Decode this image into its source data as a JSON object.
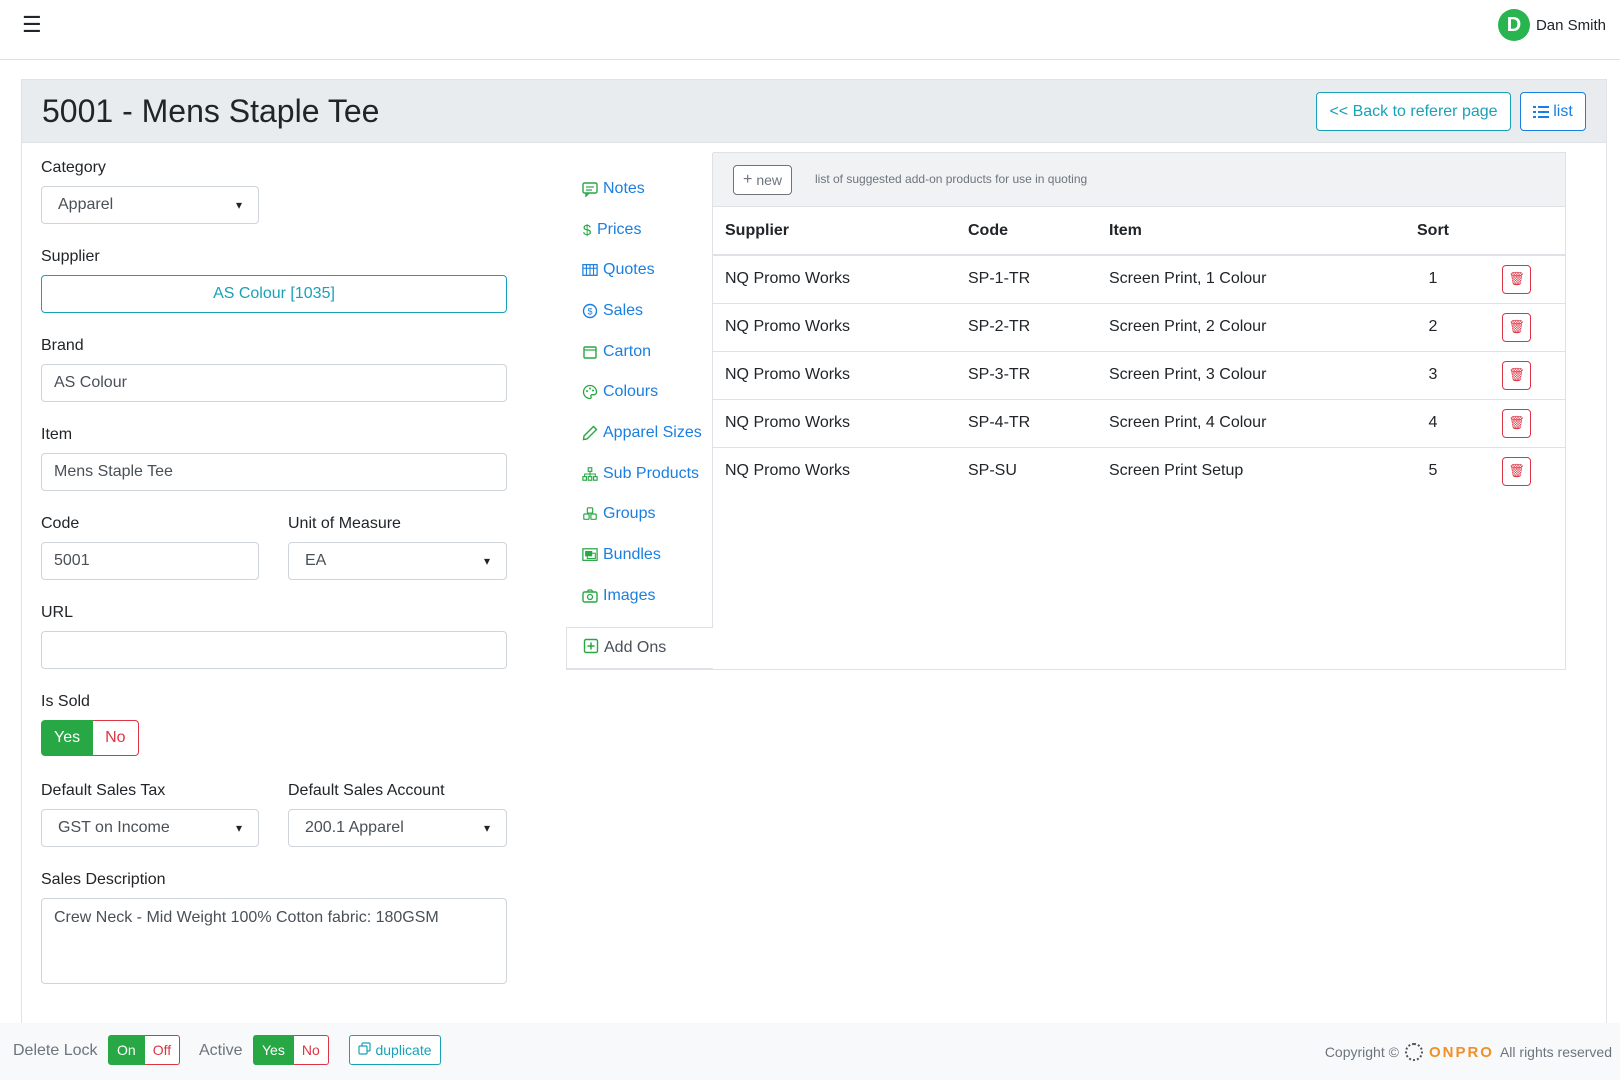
{
  "header": {
    "menu_icon": "hamburger-menu-icon",
    "user": {
      "initial": "D",
      "name": "Dan Smith",
      "avatar_color": "#28b44f"
    }
  },
  "page": {
    "title": "5001 - Mens Staple Tee",
    "back_label": "<< Back to referer page",
    "list_label": "list"
  },
  "form": {
    "category": {
      "label": "Category",
      "value": "Apparel"
    },
    "supplier": {
      "label": "Supplier",
      "value": "AS Colour [1035]"
    },
    "brand": {
      "label": "Brand",
      "value": "AS Colour"
    },
    "item": {
      "label": "Item",
      "value": "Mens Staple Tee"
    },
    "code": {
      "label": "Code",
      "value": "5001"
    },
    "unit_of_measure": {
      "label": "Unit of Measure",
      "value": "EA"
    },
    "url": {
      "label": "URL",
      "value": ""
    },
    "is_sold": {
      "label": "Is Sold",
      "yes": "Yes",
      "no": "No",
      "selected": "Yes"
    },
    "default_sales_tax": {
      "label": "Default Sales Tax",
      "value": "GST on Income"
    },
    "default_sales_account": {
      "label": "Default Sales Account",
      "value": "200.1 Apparel"
    },
    "sales_description": {
      "label": "Sales Description",
      "value": "Crew Neck - Mid Weight 100% Cotton fabric: 180GSM"
    }
  },
  "sidenav": {
    "items": [
      {
        "label": "Notes",
        "icon": "chat-icon"
      },
      {
        "label": "Prices",
        "icon": "dollar-icon"
      },
      {
        "label": "Quotes",
        "icon": "table-icon"
      },
      {
        "label": "Sales",
        "icon": "coin-icon"
      },
      {
        "label": "Carton",
        "icon": "box-icon"
      },
      {
        "label": "Colours",
        "icon": "palette-icon"
      },
      {
        "label": "Apparel Sizes",
        "icon": "ruler-pencil-icon"
      },
      {
        "label": "Sub Products",
        "icon": "hierarchy-icon"
      },
      {
        "label": "Groups",
        "icon": "boxes-icon"
      },
      {
        "label": "Bundles",
        "icon": "bundle-icon"
      },
      {
        "label": "Images",
        "icon": "camera-icon"
      }
    ],
    "active": {
      "label": "Add Ons",
      "icon": "plus-square-icon"
    }
  },
  "addons": {
    "new_label": "new",
    "hint": "list of suggested add-on products for use in quoting",
    "columns": [
      "Supplier",
      "Code",
      "Item",
      "Sort"
    ],
    "rows": [
      {
        "supplier": "NQ Promo Works",
        "code": "SP-1-TR",
        "item": "Screen Print, 1 Colour",
        "sort": "1"
      },
      {
        "supplier": "NQ Promo Works",
        "code": "SP-2-TR",
        "item": "Screen Print, 2 Colour",
        "sort": "2"
      },
      {
        "supplier": "NQ Promo Works",
        "code": "SP-3-TR",
        "item": "Screen Print, 3 Colour",
        "sort": "3"
      },
      {
        "supplier": "NQ Promo Works",
        "code": "SP-4-TR",
        "item": "Screen Print, 4 Colour",
        "sort": "4"
      },
      {
        "supplier": "NQ Promo Works",
        "code": "SP-SU",
        "item": "Screen Print Setup",
        "sort": "5"
      }
    ]
  },
  "footer": {
    "delete_lock": {
      "label": "Delete Lock",
      "on": "On",
      "off": "Off",
      "selected": "On"
    },
    "active": {
      "label": "Active",
      "yes": "Yes",
      "no": "No",
      "selected": "Yes"
    },
    "duplicate_label": "duplicate",
    "copyright_prefix": "Copyright ©",
    "brand": "ONPRO",
    "copyright_suffix": "All rights reserved"
  },
  "colors": {
    "accent_info": "#17a2b8",
    "link": "#1a7fe0",
    "success": "#28a745",
    "danger": "#dc3545"
  }
}
